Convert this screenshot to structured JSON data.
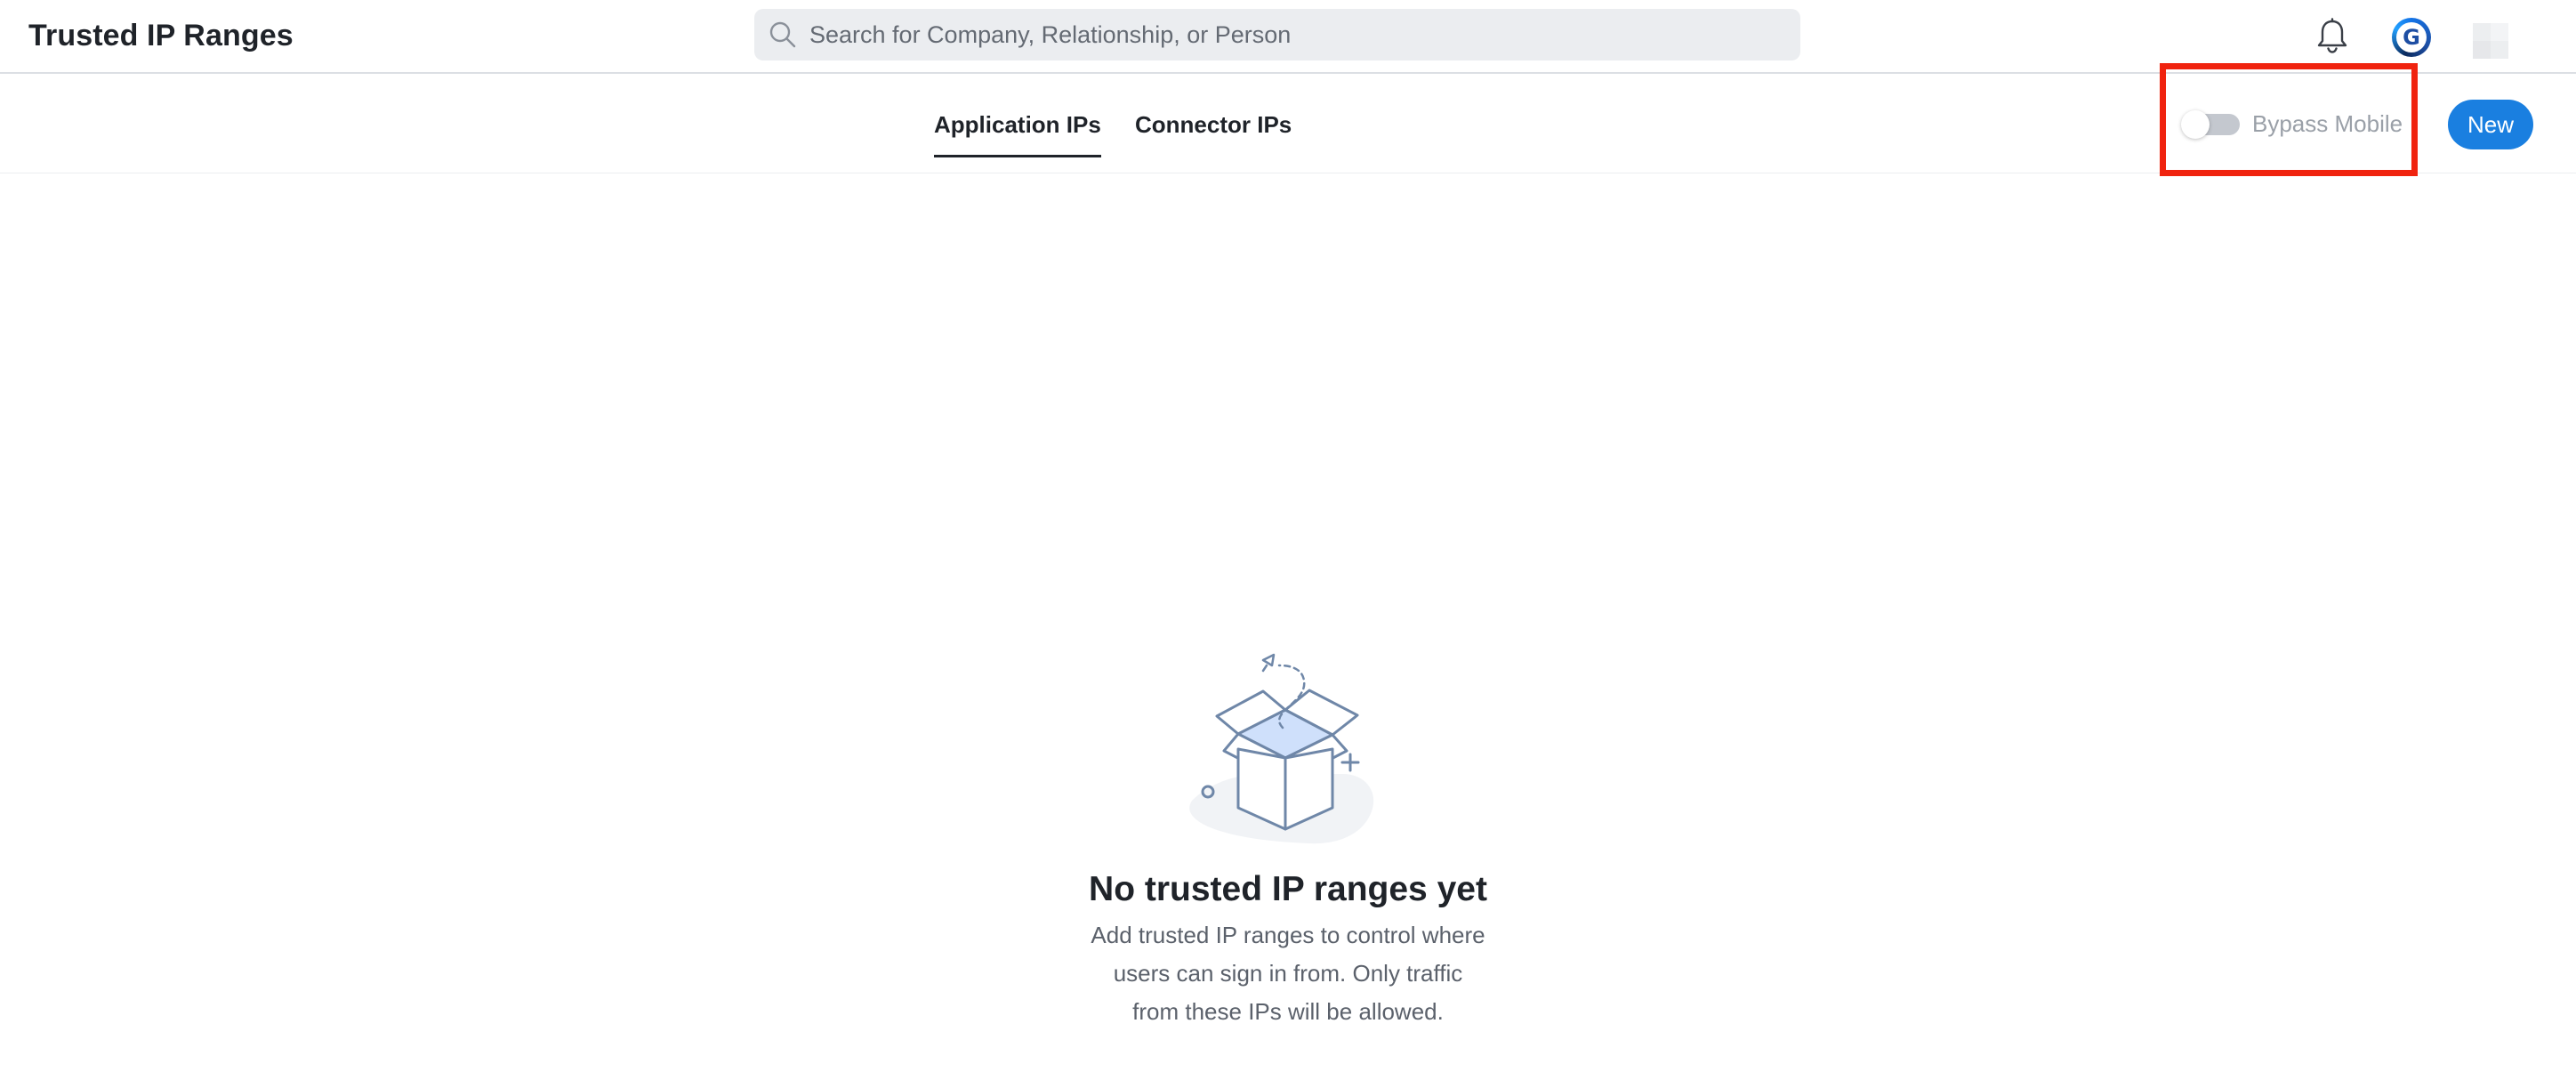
{
  "header": {
    "title": "Trusted IP Ranges",
    "search_placeholder": "Search for Company, Relationship, or Person",
    "search_icon": "search-icon",
    "notification_icon": "bell-icon",
    "avatar_letter": "G",
    "apps_icon": "apps-grid-icon"
  },
  "tabs": [
    {
      "label": "Application IPs",
      "active": true
    },
    {
      "label": "Connector IPs",
      "active": false
    }
  ],
  "toolbar": {
    "bypass_mobile_label": "Bypass Mobile",
    "bypass_mobile_enabled": false,
    "new_button_label": "New"
  },
  "empty_state": {
    "illustration": "open-box-icon",
    "title": "No trusted IP ranges yet",
    "description_lines": [
      "Add trusted IP ranges to control where",
      "users can sign in from. Only traffic",
      "from these IPs will be allowed."
    ]
  },
  "colors": {
    "accent": "#1a7fe0",
    "highlight": "#f0230f",
    "text": "#1f2329",
    "muted": "#9aa0a8",
    "search_bg": "#ebedf0",
    "illustration_stroke": "#6f87a8",
    "illustration_fill": "#cfe0fb"
  }
}
